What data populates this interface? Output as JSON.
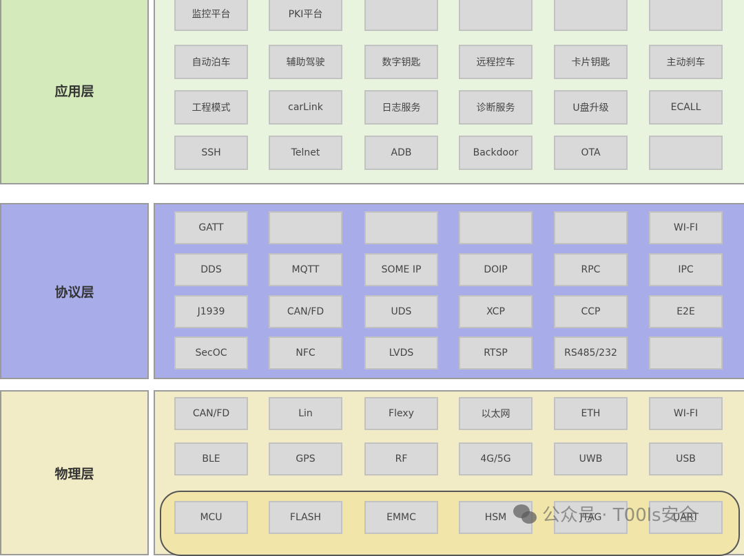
{
  "layers": [
    {
      "name": "应用层",
      "left_color": "#d5eabb",
      "right_color": "#e9f4df",
      "rows": [
        [
          "监控平台",
          "PKI平台",
          "",
          "",
          "",
          ""
        ],
        [
          "自动泊车",
          "辅助驾驶",
          "数字钥匙",
          "远程控车",
          "卡片钥匙",
          "主动刹车"
        ],
        [
          "工程模式",
          "carLink",
          "日志服务",
          "诊断服务",
          "U盘升级",
          "ECALL"
        ],
        [
          "SSH",
          "Telnet",
          "ADB",
          "Backdoor",
          "OTA",
          ""
        ]
      ]
    },
    {
      "name": "协议层",
      "left_color": "#a8ace9",
      "right_color": "#a8ace9",
      "rows": [
        [
          "GATT",
          "",
          "",
          "",
          "",
          "WI-FI"
        ],
        [
          "DDS",
          "MQTT",
          "SOME IP",
          "DOIP",
          "RPC",
          "IPC"
        ],
        [
          "J1939",
          "CAN/FD",
          "UDS",
          "XCP",
          "CCP",
          "E2E"
        ],
        [
          "SecOC",
          "NFC",
          "LVDS",
          "RTSP",
          "RS485/232",
          ""
        ]
      ]
    },
    {
      "name": "物理层",
      "left_color": "#f1ebc6",
      "right_color": "#f1ebc6",
      "rows": [
        [
          "CAN/FD",
          "Lin",
          "Flexy",
          "以太网",
          "ETH",
          "WI-FI"
        ],
        [
          "BLE",
          "GPS",
          "RF",
          "4G/5G",
          "UWB",
          "USB"
        ],
        [
          "MCU",
          "FLASH",
          "EMMC",
          "HSM",
          "JTAG",
          "UART"
        ]
      ]
    }
  ],
  "watermark": "公众号 · T00ls安全"
}
